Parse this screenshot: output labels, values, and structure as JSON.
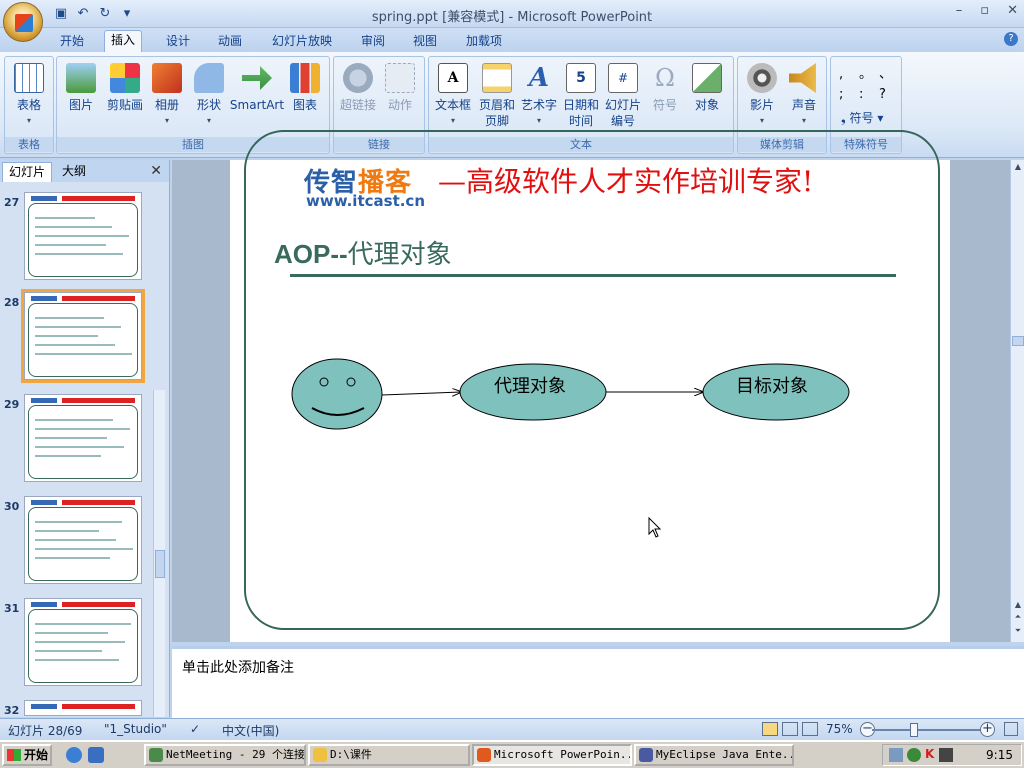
{
  "window": {
    "title": "spring.ppt [兼容模式] - Microsoft PowerPoint"
  },
  "quick_access": {
    "icons": [
      "save-icon",
      "undo-icon",
      "redo-icon",
      "customize-icon"
    ]
  },
  "tabs": [
    {
      "label": "开始"
    },
    {
      "label": "插入",
      "active": true
    },
    {
      "label": "设计"
    },
    {
      "label": "动画"
    },
    {
      "label": "幻灯片放映"
    },
    {
      "label": "审阅"
    },
    {
      "label": "视图"
    },
    {
      "label": "加载项"
    }
  ],
  "ribbon": {
    "groups": {
      "table": {
        "label": "表格",
        "buttons": [
          {
            "label": "表格"
          }
        ]
      },
      "illustrations": {
        "label": "插图",
        "buttons": [
          {
            "label": "图片"
          },
          {
            "label": "剪贴画"
          },
          {
            "label": "相册"
          },
          {
            "label": "形状"
          },
          {
            "label": "SmartArt"
          },
          {
            "label": "图表"
          }
        ]
      },
      "links": {
        "label": "链接",
        "buttons": [
          {
            "label": "超链接"
          },
          {
            "label": "动作"
          }
        ]
      },
      "text": {
        "label": "文本",
        "buttons": [
          {
            "label": "文本框"
          },
          {
            "label": "页眉和页脚"
          },
          {
            "label": "艺术字"
          },
          {
            "label": "日期和时间"
          },
          {
            "label": "幻灯片编号"
          },
          {
            "label": "符号"
          },
          {
            "label": "对象"
          }
        ]
      },
      "media": {
        "label": "媒体剪辑",
        "buttons": [
          {
            "label": "影片"
          },
          {
            "label": "声音"
          }
        ]
      },
      "special": {
        "label": "特殊符号",
        "symbols": [
          ",",
          "。",
          "、",
          ";",
          ":",
          "?"
        ],
        "button": "符号"
      }
    }
  },
  "slide_pane": {
    "tabs": [
      {
        "label": "幻灯片"
      },
      {
        "label": "大纲"
      }
    ],
    "thumbnails": [
      {
        "num": "27"
      },
      {
        "num": "28",
        "selected": true
      },
      {
        "num": "29"
      },
      {
        "num": "30"
      },
      {
        "num": "31"
      },
      {
        "num": "32"
      }
    ]
  },
  "slide": {
    "logo_cn_a": "传智",
    "logo_cn_b": "播客",
    "logo_url": "www.itcast.cn",
    "slogan": "—高级软件人才实作培训专家!",
    "title_bold": "AOP--",
    "title_rest": "代理对象",
    "nodes": {
      "proxy": "代理对象",
      "target": "目标对象"
    },
    "colors": {
      "node_fill": "#7fc2bd",
      "frame": "#35665a",
      "slogan": "#e01010",
      "logo": "#2b5fa8"
    }
  },
  "notes": {
    "placeholder": "单击此处添加备注"
  },
  "status": {
    "slide_info": "幻灯片 28/69",
    "theme": "\"1_Studio\"",
    "language": "中文(中国)",
    "zoom": "75%"
  },
  "taskbar": {
    "start": "开始",
    "tasks": [
      {
        "label": "NetMeeting - 29 个连接"
      },
      {
        "label": "D:\\课件"
      },
      {
        "label": "Microsoft PowerPoin...",
        "active": true
      },
      {
        "label": "MyEclipse Java Ente..."
      }
    ],
    "clock": "9:15"
  }
}
